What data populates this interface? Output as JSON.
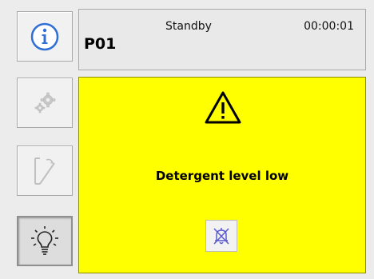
{
  "status": {
    "program_code": "P01",
    "state": "Standby",
    "timer": "00:00:01"
  },
  "sidebar": {
    "items": [
      {
        "name": "info",
        "icon": "info-icon",
        "enabled": true
      },
      {
        "name": "settings",
        "icon": "gears-icon",
        "enabled": false
      },
      {
        "name": "door",
        "icon": "door-open-icon",
        "enabled": false
      },
      {
        "name": "light",
        "icon": "lightbulb-icon",
        "enabled": true,
        "pressed": true
      }
    ]
  },
  "alert": {
    "icon": "warning-triangle-icon",
    "message": "Detergent level low",
    "mute_icon": "alarm-bell-muted-icon",
    "background_color": "#ffff00"
  }
}
